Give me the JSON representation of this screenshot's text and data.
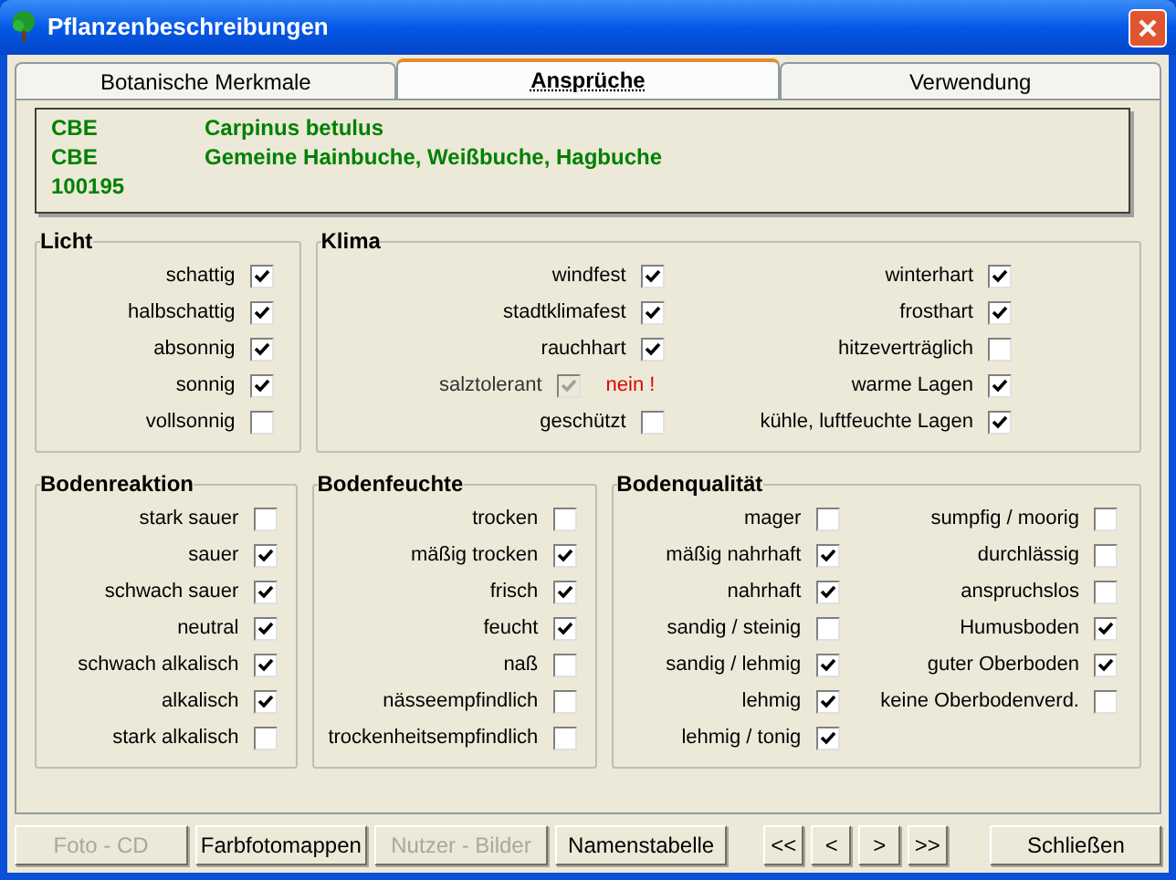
{
  "window": {
    "title": "Pflanzenbeschreibungen"
  },
  "tabs": [
    {
      "label": "Botanische Merkmale",
      "selected": false
    },
    {
      "label": "Ansprüche",
      "selected": true
    },
    {
      "label": "Verwendung",
      "selected": false
    }
  ],
  "info": [
    {
      "code": "CBE",
      "text": "Carpinus betulus"
    },
    {
      "code": "CBE",
      "text": "Gemeine Hainbuche, Weißbuche, Hagbuche"
    },
    {
      "code": "100195"
    }
  ],
  "groups_top": [
    {
      "title": "Licht",
      "columns": [
        [
          {
            "label": "schattig",
            "checked": true
          },
          {
            "label": "halbschattig",
            "checked": true
          },
          {
            "label": "absonnig",
            "checked": true
          },
          {
            "label": "sonnig",
            "checked": true
          },
          {
            "label": "vollsonnig",
            "checked": false
          }
        ]
      ]
    },
    {
      "title": "Klima",
      "columns": [
        [
          {
            "label": "windfest",
            "checked": true
          },
          {
            "label": "stadtklimafest",
            "checked": true
          },
          {
            "label": "rauchhart",
            "checked": true
          },
          {
            "label": "salztolerant",
            "checked": true,
            "disabled": true,
            "note": "nein !"
          },
          {
            "label": "geschützt",
            "checked": false
          }
        ],
        [
          {
            "label": "winterhart",
            "checked": true
          },
          {
            "label": "frosthart",
            "checked": true
          },
          {
            "label": "hitzeverträglich",
            "checked": false
          },
          {
            "label": "warme Lagen",
            "checked": true
          },
          {
            "label": "kühle, luftfeuchte Lagen",
            "checked": true
          }
        ]
      ]
    }
  ],
  "groups_bottom": [
    {
      "title": "Bodenreaktion",
      "columns": [
        [
          {
            "label": "stark sauer",
            "checked": false
          },
          {
            "label": "sauer",
            "checked": true
          },
          {
            "label": "schwach sauer",
            "checked": true
          },
          {
            "label": "neutral",
            "checked": true
          },
          {
            "label": "schwach alkalisch",
            "checked": true
          },
          {
            "label": "alkalisch",
            "checked": true
          },
          {
            "label": "stark alkalisch",
            "checked": false
          }
        ]
      ]
    },
    {
      "title": "Bodenfeuchte",
      "columns": [
        [
          {
            "label": "trocken",
            "checked": false
          },
          {
            "label": "mäßig trocken",
            "checked": true
          },
          {
            "label": "frisch",
            "checked": true
          },
          {
            "label": "feucht",
            "checked": true
          },
          {
            "label": "naß",
            "checked": false
          },
          {
            "label": "nässeempfindlich",
            "checked": false
          },
          {
            "label": "trockenheitsempfindlich",
            "checked": false
          }
        ]
      ]
    },
    {
      "title": "Bodenqualität",
      "columns": [
        [
          {
            "label": "mager",
            "checked": false
          },
          {
            "label": "mäßig nahrhaft",
            "checked": true
          },
          {
            "label": "nahrhaft",
            "checked": true
          },
          {
            "label": "sandig / steinig",
            "checked": false
          },
          {
            "label": "sandig / lehmig",
            "checked": true
          },
          {
            "label": "lehmig",
            "checked": true
          },
          {
            "label": "lehmig / tonig",
            "checked": true
          }
        ],
        [
          {
            "label": "sumpfig / moorig",
            "checked": false
          },
          {
            "label": "durchlässig",
            "checked": false
          },
          {
            "label": "anspruchslos",
            "checked": false
          },
          {
            "label": "Humusboden",
            "checked": true
          },
          {
            "label": "guter Oberboden",
            "checked": true
          },
          {
            "label": "keine Oberbodenverd.",
            "checked": false
          }
        ]
      ]
    }
  ],
  "buttons": [
    {
      "label": "Foto - CD",
      "disabled": true
    },
    {
      "label": "Farbfotomappen",
      "disabled": false
    },
    {
      "label": "Nutzer - Bilder",
      "disabled": true
    },
    {
      "label": "Namenstabelle",
      "disabled": false
    }
  ],
  "nav_buttons": [
    {
      "label": "<<"
    },
    {
      "label": "<"
    },
    {
      "label": ">"
    },
    {
      "label": ">>"
    }
  ],
  "close_button": {
    "label": "Schließen"
  }
}
